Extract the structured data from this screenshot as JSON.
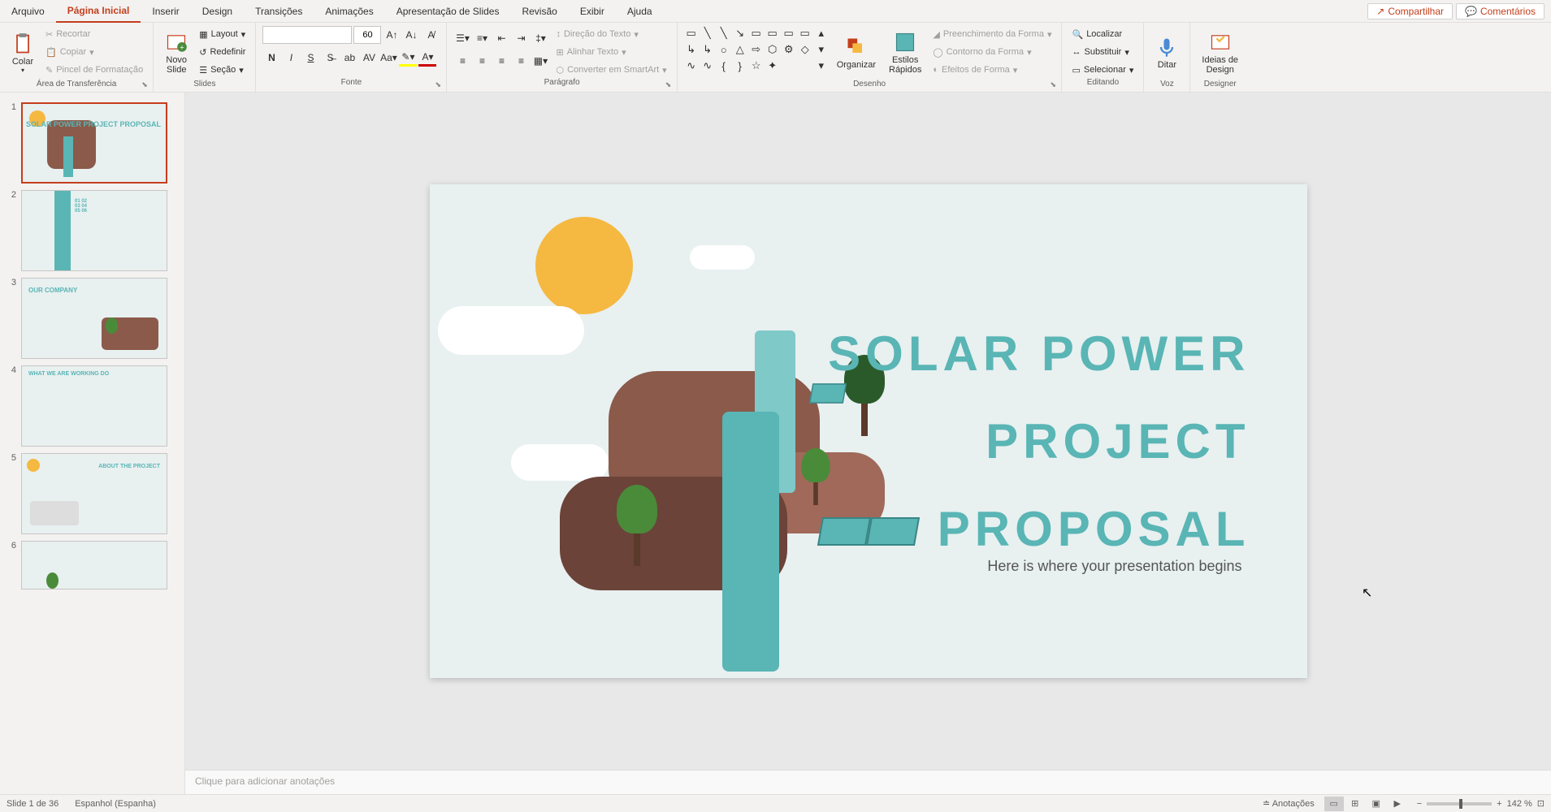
{
  "tabs": {
    "arquivo": "Arquivo",
    "home": "Página Inicial",
    "inserir": "Inserir",
    "design": "Design",
    "transicoes": "Transições",
    "animacoes": "Animações",
    "apresentacao": "Apresentação de Slides",
    "revisao": "Revisão",
    "exibir": "Exibir",
    "ajuda": "Ajuda"
  },
  "topButtons": {
    "share": "Compartilhar",
    "comments": "Comentários"
  },
  "ribbon": {
    "clipboard": {
      "label": "Área de Transferência",
      "paste": "Colar",
      "cut": "Recortar",
      "copy": "Copiar",
      "formatPainter": "Pincel de Formatação"
    },
    "slides": {
      "label": "Slides",
      "newSlide": "Novo\nSlide",
      "layout": "Layout",
      "reset": "Redefinir",
      "section": "Seção"
    },
    "font": {
      "label": "Fonte",
      "size": "60"
    },
    "paragraph": {
      "label": "Parágrafo",
      "textDirection": "Direção do Texto",
      "alignText": "Alinhar Texto",
      "smartArt": "Converter em SmartArt"
    },
    "drawing": {
      "label": "Desenho",
      "arrange": "Organizar",
      "quickStyles": "Estilos\nRápidos",
      "shapeFill": "Preenchimento da Forma",
      "shapeOutline": "Contorno da Forma",
      "shapeEffects": "Efeitos de Forma"
    },
    "editing": {
      "label": "Editando",
      "find": "Localizar",
      "replace": "Substituir",
      "select": "Selecionar"
    },
    "voice": {
      "label": "Voz",
      "dictate": "Ditar"
    },
    "designer": {
      "label": "Designer",
      "ideas": "Ideias de\nDesign"
    }
  },
  "slideContent": {
    "title": "SOLAR POWER\nPROJECT\nPROPOSAL",
    "subtitle": "Here is where your presentation begins"
  },
  "thumbs": [
    {
      "num": "1",
      "label": "SOLAR POWER PROJECT PROPOSAL"
    },
    {
      "num": "2",
      "label": "01 02 03 04 05 06"
    },
    {
      "num": "3",
      "label": "OUR COMPANY"
    },
    {
      "num": "4",
      "label": "WHAT WE ARE WORKING DO"
    },
    {
      "num": "5",
      "label": "ABOUT THE PROJECT"
    },
    {
      "num": "6",
      "label": ""
    }
  ],
  "notes": {
    "placeholder": "Clique para adicionar anotações"
  },
  "status": {
    "slideCount": "Slide 1 de 36",
    "language": "Espanhol (Espanha)",
    "notes": "Anotações",
    "zoom": "142 %"
  }
}
